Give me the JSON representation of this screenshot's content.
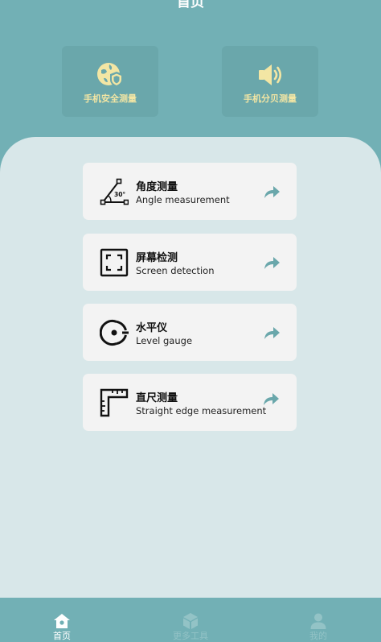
{
  "header": {
    "title": "首页"
  },
  "top_cards": [
    {
      "label": "手机安全测量",
      "icon": "shield-globe-icon"
    },
    {
      "label": "手机分贝测量",
      "icon": "speaker-icon"
    }
  ],
  "tools": [
    {
      "title": "角度测量",
      "subtitle": "Angle measurement",
      "icon": "angle-icon",
      "icon_text": "30°"
    },
    {
      "title": "屏幕检测",
      "subtitle": "Screen detection",
      "icon": "screen-frame-icon"
    },
    {
      "title": "水平仪",
      "subtitle": "Level gauge",
      "icon": "level-icon"
    },
    {
      "title": "直尺测量",
      "subtitle": "Straight edge measurement",
      "icon": "ruler-icon"
    }
  ],
  "bottom_nav": [
    {
      "label": "首页",
      "icon": "home-icon",
      "active": true
    },
    {
      "label": "更多工具",
      "icon": "cube-icon",
      "active": false
    },
    {
      "label": "我的",
      "icon": "user-icon",
      "active": false
    }
  ],
  "colors": {
    "background": "#72b0b5",
    "panel": "#d8e7e9",
    "card": "#f3f3f3",
    "accent_label": "#f3e6a4",
    "arrow": "#6aa7ab",
    "nav_inactive": "#93c3c6"
  }
}
